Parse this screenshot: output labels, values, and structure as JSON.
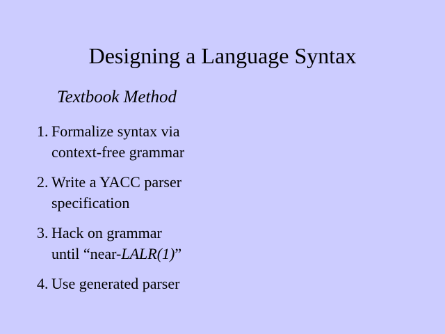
{
  "slide": {
    "title": "Designing a Language Syntax",
    "subtitle": "Textbook Method",
    "items": [
      {
        "number": "1.",
        "line1": "Formalize syntax via",
        "line2": "context-free grammar"
      },
      {
        "number": "2.",
        "line1": "Write a YACC parser",
        "line2": "specification"
      },
      {
        "number": "3.",
        "line1": "Hack on grammar",
        "line2_prefix": "until “near-",
        "line2_italic": "LALR(1)",
        "line2_suffix": "”"
      },
      {
        "number": "4.",
        "line1": "Use generated parser"
      }
    ]
  },
  "colors": {
    "background": "#ccccff",
    "text": "#000000"
  }
}
